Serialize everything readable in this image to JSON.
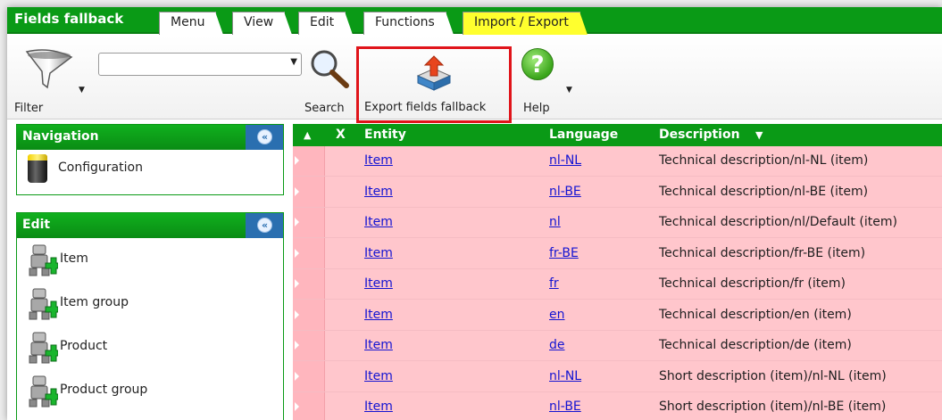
{
  "window": {
    "title": "Fields fallback"
  },
  "tabs": [
    {
      "label": "Menu",
      "active": false
    },
    {
      "label": "View",
      "active": false
    },
    {
      "label": "Edit",
      "active": false
    },
    {
      "label": "Functions",
      "active": false
    },
    {
      "label": "Import / Export",
      "active": true
    }
  ],
  "toolbar": {
    "filter_label": "Filter",
    "filter_value": "",
    "search_label": "Search",
    "export_label": "Export fields fallback",
    "help_label": "Help",
    "help_glyph": "?"
  },
  "navigation": {
    "title": "Navigation",
    "collapse_glyph": "«",
    "items": [
      {
        "label": "Configuration",
        "icon": "battery-icon"
      }
    ]
  },
  "edit_panel": {
    "title": "Edit",
    "collapse_glyph": "«",
    "items": [
      {
        "label": "Item",
        "icon": "robot-add-icon"
      },
      {
        "label": "Item group",
        "icon": "robot-add-icon"
      },
      {
        "label": "Product",
        "icon": "robot-add-icon"
      },
      {
        "label": "Product group",
        "icon": "robot-add-icon"
      }
    ]
  },
  "grid": {
    "columns": {
      "sort_glyph": "▲",
      "x": "X",
      "entity": "Entity",
      "language": "Language",
      "description": "Description",
      "desc_sort_glyph": "▼"
    },
    "rows": [
      {
        "entity": "Item",
        "language": "nl-NL",
        "description": "Technical description/nl-NL (item)"
      },
      {
        "entity": "Item",
        "language": "nl-BE",
        "description": "Technical description/nl-BE (item)"
      },
      {
        "entity": "Item",
        "language": "nl",
        "description": "Technical description/nl/Default (item)"
      },
      {
        "entity": "Item",
        "language": "fr-BE",
        "description": "Technical description/fr-BE (item)"
      },
      {
        "entity": "Item",
        "language": "fr",
        "description": "Technical description/fr (item)"
      },
      {
        "entity": "Item",
        "language": "en",
        "description": "Technical description/en (item)"
      },
      {
        "entity": "Item",
        "language": "de",
        "description": "Technical description/de (item)"
      },
      {
        "entity": "Item",
        "language": "nl-NL",
        "description": "Short description (item)/nl-NL (item)"
      },
      {
        "entity": "Item",
        "language": "nl-BE",
        "description": "Short description (item)/nl-BE (item)"
      }
    ]
  },
  "colors": {
    "header_green": "#0a9a16",
    "active_tab": "#ffff2e",
    "row_background": "#ffc6cc",
    "link_blue": "#1414d2",
    "highlight_red": "#e0141a",
    "collapse_blue": "#2a6fb0"
  }
}
